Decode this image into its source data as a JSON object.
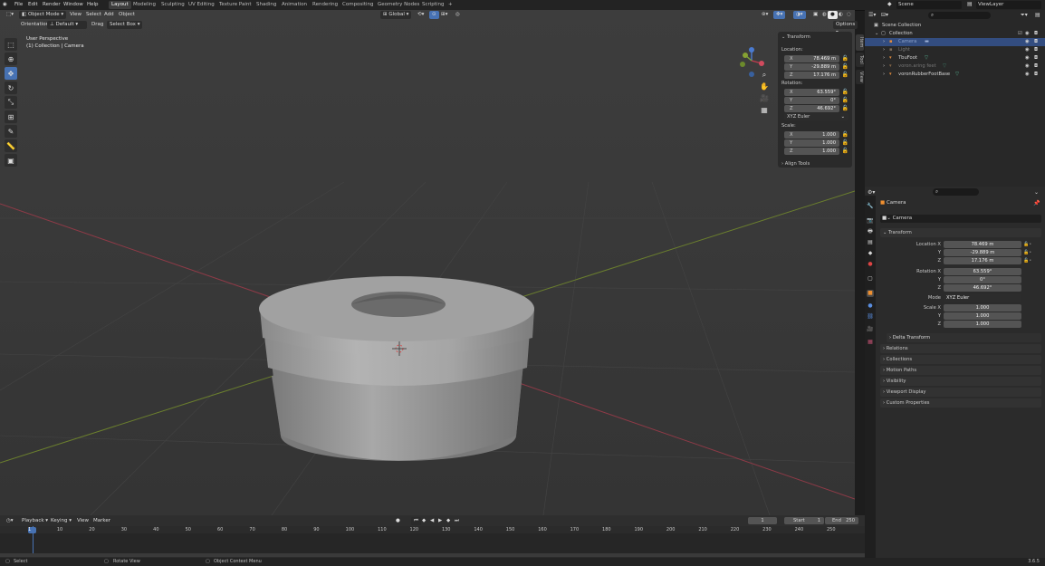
{
  "menu": [
    "File",
    "Edit",
    "Render",
    "Window",
    "Help"
  ],
  "workspaces": [
    "Layout",
    "Modeling",
    "Sculpting",
    "UV Editing",
    "Texture Paint",
    "Shading",
    "Animation",
    "Rendering",
    "Compositing",
    "Geometry Nodes",
    "Scripting"
  ],
  "active_workspace": "Layout",
  "scene_field": "Scene",
  "viewlayer_field": "ViewLayer",
  "viewport_header": {
    "mode": "Object Mode",
    "menus": [
      "View",
      "Select",
      "Add",
      "Object"
    ],
    "transform_orientation": "Global"
  },
  "viewport_header2": {
    "orientation_label": "Orientation:",
    "orientation_value": "Default",
    "drag_label": "Drag",
    "drag_value": "Select Box",
    "options": "Options"
  },
  "viewport_overlay": {
    "line1": "User Perspective",
    "line2": "(1) Collection | Camera"
  },
  "npanel": {
    "section": "Transform",
    "location_label": "Location:",
    "location": {
      "x": "78.469 m",
      "y": "-29.889 m",
      "z": "17.176 m"
    },
    "rotation_label": "Rotation:",
    "rotation": {
      "x": "63.559°",
      "y": "0°",
      "z": "46.692°"
    },
    "rotation_mode": "XYZ Euler",
    "scale_label": "Scale:",
    "scale": {
      "x": "1.000",
      "y": "1.000",
      "z": "1.000"
    },
    "align_tools": "Align Tools",
    "tabs": [
      "Item",
      "Tool",
      "View"
    ]
  },
  "outliner": {
    "root": "Scene Collection",
    "collection": "Collection",
    "items": [
      {
        "name": "Camera",
        "selected": true,
        "dim": false
      },
      {
        "name": "Light",
        "selected": false,
        "dim": true
      },
      {
        "name": "TbuFoot",
        "selected": false,
        "dim": false
      },
      {
        "name": "voron.aring feet",
        "selected": false,
        "dim": true
      },
      {
        "name": "voronRubberFootBase",
        "selected": false,
        "dim": false
      }
    ]
  },
  "properties": {
    "object_name": "Camera",
    "datablock": "Camera",
    "transform_header": "Transform",
    "rows": [
      {
        "label": "Location X",
        "value": "78.469 m"
      },
      {
        "label": "Y",
        "value": "-29.889 m"
      },
      {
        "label": "Z",
        "value": "17.176 m"
      },
      {
        "label": "Rotation X",
        "value": "63.559°"
      },
      {
        "label": "Y",
        "value": "0°"
      },
      {
        "label": "Z",
        "value": "46.692°"
      }
    ],
    "mode_label": "Mode",
    "mode_value": "XYZ Euler",
    "scale_rows": [
      {
        "label": "Scale X",
        "value": "1.000"
      },
      {
        "label": "Y",
        "value": "1.000"
      },
      {
        "label": "Z",
        "value": "1.000"
      }
    ],
    "delta": "Delta Transform",
    "panels": [
      "Relations",
      "Collections",
      "Motion Paths",
      "Visibility",
      "Viewport Display",
      "Custom Properties"
    ]
  },
  "timeline": {
    "menus": [
      "Playback",
      "Keying",
      "View",
      "Marker"
    ],
    "current_frame": "1",
    "start_label": "Start",
    "start": "1",
    "end_label": "End",
    "end": "250",
    "ticks": [
      "1",
      "10",
      "20",
      "30",
      "40",
      "50",
      "60",
      "70",
      "80",
      "90",
      "100",
      "110",
      "120",
      "130",
      "140",
      "150",
      "160",
      "170",
      "180",
      "190",
      "200",
      "210",
      "220",
      "230",
      "240",
      "250"
    ]
  },
  "statusbar": {
    "select": "Select",
    "rotate": "Rotate View",
    "context": "Object Context Menu",
    "version": "3.6.5"
  },
  "colors": {
    "accent": "#4772b3",
    "selected_row": "#334d80",
    "x_axis": "#c2415a",
    "y_axis": "#86a232"
  }
}
